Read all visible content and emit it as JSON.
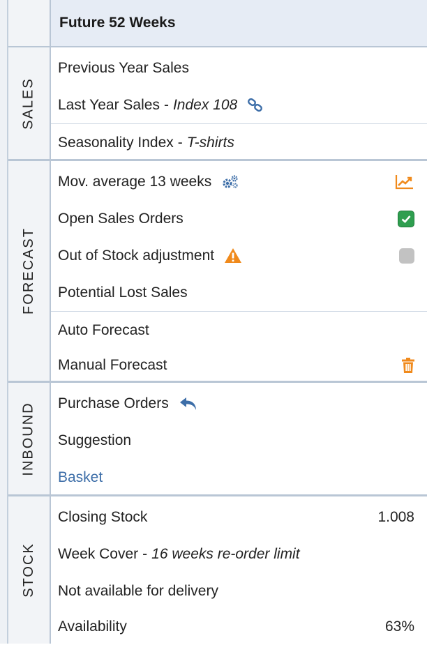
{
  "header": {
    "title": "Future 52 Weeks"
  },
  "sections": {
    "sales": {
      "label": "SALES",
      "rows": [
        {
          "text": "Previous Year Sales"
        },
        {
          "text": "Last Year Sales",
          "italic": "Index 108",
          "icon": "link-icon"
        },
        {
          "text": "Seasonality Index",
          "italic": "T-shirts"
        }
      ]
    },
    "forecast": {
      "label": "FORECAST",
      "rows": [
        {
          "text": "Mov. average 13 weeks",
          "icon": "gears-icon",
          "right_icon": "trend-chart-icon"
        },
        {
          "text": "Open Sales Orders",
          "right_icon": "checkbox-checked-icon",
          "checked": true
        },
        {
          "text": "Out of Stock adjustment",
          "icon": "warning-icon",
          "right_icon": "checkbox-unchecked-icon",
          "checked": false
        },
        {
          "text": "Potential Lost Sales"
        },
        {
          "text": "Auto Forecast"
        },
        {
          "text": "Manual Forecast",
          "right_icon": "trash-icon"
        }
      ]
    },
    "inbound": {
      "label": "INBOUND",
      "rows": [
        {
          "text": "Purchase Orders",
          "icon": "reply-arrow-icon"
        },
        {
          "text": "Suggestion"
        },
        {
          "text": "Basket"
        }
      ]
    },
    "stock": {
      "label": "STOCK",
      "rows": [
        {
          "text": "Closing Stock",
          "value": "1.008"
        },
        {
          "text": "Week Cover",
          "italic": "16 weeks re-order limit"
        },
        {
          "text": "Not available for delivery"
        },
        {
          "text": "Availability",
          "value": "63%"
        }
      ]
    }
  },
  "separator": "-",
  "colors": {
    "accent_blue": "#3d6ea8",
    "accent_orange": "#f08a1c",
    "checkbox_green": "#2f9e4f",
    "checkbox_gray": "#c2c2c2",
    "header_bg": "#e6ecf5",
    "border": "#b9c6d5"
  }
}
